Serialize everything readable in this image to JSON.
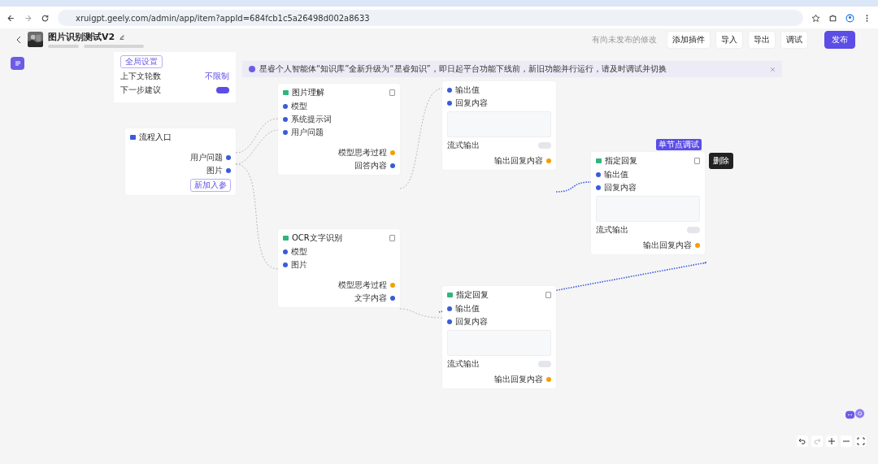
{
  "browser": {
    "url": "xruigpt.geely.com/admin/app/item?appId=684fcb1c5a26498d002a8633"
  },
  "header": {
    "title": "图片识别测试V2",
    "status": "有尚未发布的修改",
    "buttons": [
      {
        "label": "添加插件",
        "kind": "plain"
      },
      {
        "label": "导入",
        "kind": "plain"
      },
      {
        "label": "导出",
        "kind": "plain"
      },
      {
        "label": "调试",
        "kind": "plain"
      },
      {
        "label": "发布",
        "kind": "primary"
      }
    ]
  },
  "banner": {
    "text": "星睿个人智能体“知识库”全新升级为“星睿知识”，即日起平台功能下线前，新旧功能并行运行，请及时调试并切换"
  },
  "settings_card": {
    "button": "全局设置",
    "rows": [
      {
        "label": "上下文轮数",
        "kind": "value",
        "value": "不限制"
      },
      {
        "label": "下一步建议",
        "kind": "toggle",
        "on": true
      }
    ]
  },
  "nodes": [
    {
      "kind": "start",
      "title": "流程入口",
      "outputs": [
        {
          "label": "用户问题",
          "color": "#3b5bdb"
        },
        {
          "label": "图片",
          "color": "#3b5bdb"
        }
      ],
      "add_button": "新加入参"
    },
    {
      "kind": "llm",
      "title": "图片理解",
      "inputs": [
        "模型",
        "系统提示词",
        "用户问题"
      ],
      "outputs": [
        {
          "label": "模型思考过程",
          "color": "#f59f00"
        },
        {
          "label": "回答内容",
          "color": "#3b5bdb"
        }
      ]
    },
    {
      "kind": "reply",
      "inputs": [
        "输出值",
        "回复内容"
      ],
      "toggle": {
        "label": "流式输出",
        "on": false
      },
      "footer": "输出回复内容"
    },
    {
      "kind": "reply",
      "badge": "单节点调试",
      "title": "指定回复",
      "inputs": [
        "输出值",
        "回复内容"
      ],
      "toggle": {
        "label": "流式输出",
        "on": false
      },
      "footer": "输出回复内容"
    },
    {
      "kind": "llm",
      "title": "OCR文字识别",
      "inputs": [
        "模型",
        "图片"
      ],
      "outputs": [
        {
          "label": "模型思考过程",
          "color": "#f59f00"
        },
        {
          "label": "文字内容",
          "color": "#3b5bdb"
        }
      ]
    },
    {
      "kind": "reply",
      "title": "指定回复",
      "inputs": [
        "输出值",
        "回复内容"
      ],
      "toggle": {
        "label": "流式输出",
        "on": false
      },
      "footer": "输出回复内容"
    }
  ],
  "tooltip": {
    "text": "删除"
  }
}
